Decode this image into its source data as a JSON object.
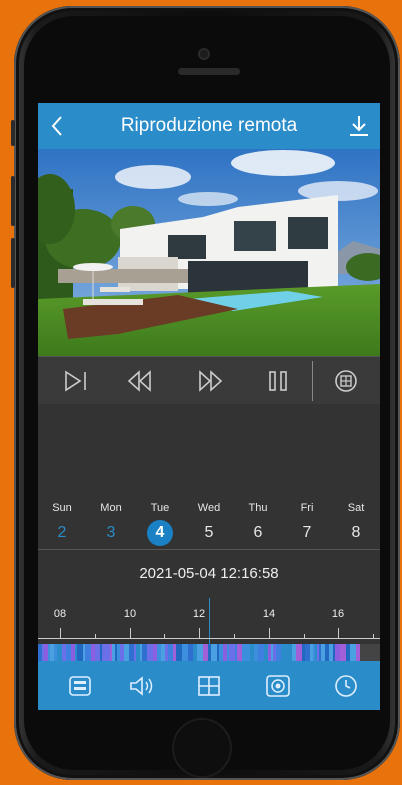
{
  "header": {
    "title": "Riproduzione remota"
  },
  "calendar": {
    "days": [
      {
        "weekday": "Sun",
        "num": "2",
        "state": "past"
      },
      {
        "weekday": "Mon",
        "num": "3",
        "state": "past"
      },
      {
        "weekday": "Tue",
        "num": "4",
        "state": "selected"
      },
      {
        "weekday": "Wed",
        "num": "5",
        "state": "future"
      },
      {
        "weekday": "Thu",
        "num": "6",
        "state": "future"
      },
      {
        "weekday": "Fri",
        "num": "7",
        "state": "future"
      },
      {
        "weekday": "Sat",
        "num": "8",
        "state": "future"
      }
    ]
  },
  "playback": {
    "datetime": "2021-05-04 12:16:58"
  },
  "timeline": {
    "hour_labels": [
      "08",
      "10",
      "12",
      "14",
      "16"
    ]
  },
  "icons": {
    "back": "chevron-left-icon",
    "download": "download-icon",
    "frame_step": "frame-step-icon",
    "rewind": "rewind-icon",
    "fast_forward": "fast-forward-icon",
    "pause": "pause-icon",
    "multi_channel": "multi-channel-icon",
    "record_list": "record-list-icon",
    "audio": "speaker-icon",
    "layout": "grid-layout-icon",
    "snapshot": "snapshot-icon",
    "time": "clock-icon"
  },
  "colors": {
    "accent": "#2a8cc9",
    "background": "#e8720c"
  }
}
